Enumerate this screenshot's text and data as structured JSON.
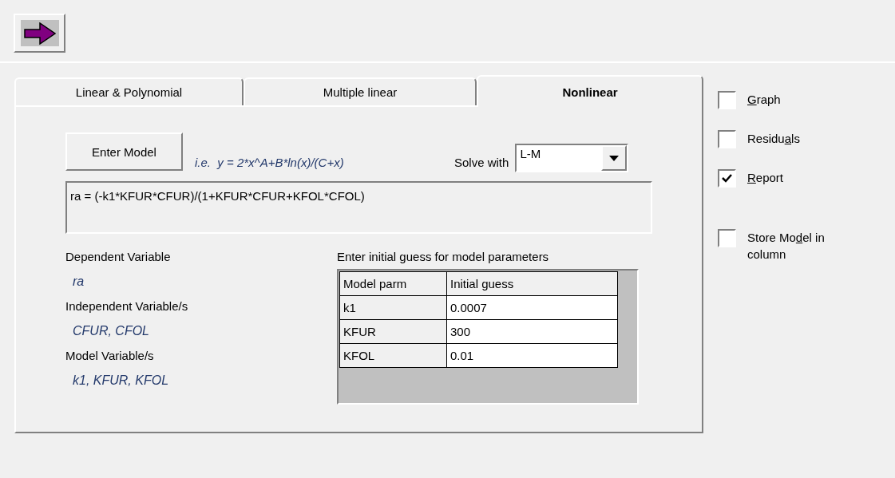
{
  "toolbar": {
    "run_button": {
      "enabled": true
    }
  },
  "tabs": [
    {
      "label": "Linear & Polynomial",
      "selected": false
    },
    {
      "label": "Multiple linear",
      "selected": false
    },
    {
      "label": "Nonlinear",
      "selected": true
    }
  ],
  "model": {
    "button": "Enter Model",
    "example": "i.e.  y = 2*x^A+B*ln(x)/(C+x)",
    "solve_label": "Solve with",
    "solver": "L-M",
    "formula": "ra = (-k1*KFUR*CFUR)/(1+KFUR*CFUR+KFOL*CFOL)"
  },
  "variables": [
    {
      "label": "Dependent Variable",
      "value": "ra"
    },
    {
      "label": "Independent Variable/s",
      "value": "CFUR, CFOL"
    },
    {
      "label": "Model Variable/s",
      "value": "k1, KFUR, KFOL"
    }
  ],
  "parameters": {
    "title": "Enter initial guess for model parameters",
    "columns": [
      "Model parm",
      "Initial guess"
    ],
    "rows": [
      [
        "k1",
        "0.0007"
      ],
      [
        "KFUR",
        "300"
      ],
      [
        "KFOL",
        "0.01"
      ]
    ]
  },
  "options": [
    {
      "label": {
        "key": "G",
        "post": "raph"
      },
      "checked": false
    },
    {
      "label": {
        "pre": "Residu",
        "key": "a",
        "post": "ls"
      },
      "checked": false
    },
    {
      "label": {
        "key": "R",
        "post": "eport"
      },
      "checked": true
    },
    {
      "label": {
        "pre": "Store Mo",
        "key": "d",
        "post": "el in column"
      },
      "checked": false
    }
  ]
}
